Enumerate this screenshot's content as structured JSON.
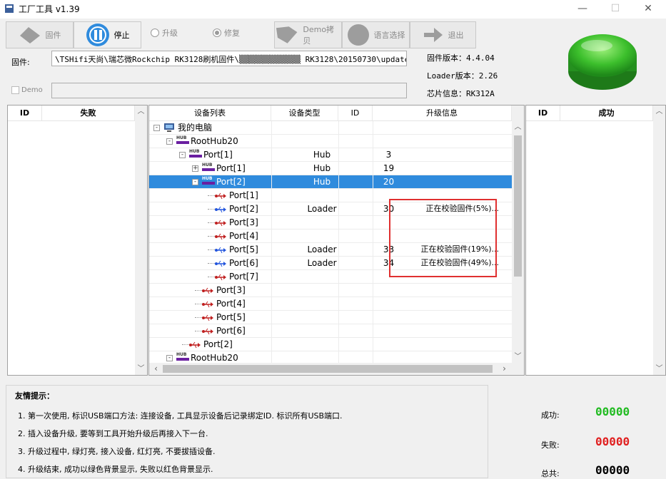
{
  "window": {
    "title": "工厂工具 v1.39",
    "minimize": "—",
    "maximize": "☐",
    "close": "✕"
  },
  "toolbar": {
    "firmware": "固件",
    "stop": "停止",
    "upgrade": "升级",
    "repair": "修复",
    "demo_copy": "Demo拷贝",
    "language": "语言选择",
    "exit": "退出",
    "selected_mode": "repair"
  },
  "firmware_row": {
    "label": "固件:",
    "path": "\\TSHifi天尚\\瑞芯微Rockchip RK3128刷机固件\\▒▒▒▒▒▒▒▒▒▒▒▒▒ RK3128\\20150730\\update.img",
    "demo_label": "Demo",
    "demo_value": ""
  },
  "versions": {
    "firmware_version": "固件版本：4.4.04",
    "loader_version": "Loader版本：2.26",
    "chip_info": "芯片信息：RK312A"
  },
  "fail_panel": {
    "col_id": "ID",
    "col_title": "失败"
  },
  "success_panel": {
    "col_id": "ID",
    "col_title": "成功"
  },
  "devices": {
    "headers": [
      "设备列表",
      "设备类型",
      "ID",
      "升级信息"
    ],
    "rows": [
      {
        "name": "我的电脑",
        "type": "",
        "id": "",
        "info": "",
        "icon": "computer-icon",
        "level": 0,
        "expander": "-"
      },
      {
        "name": "RootHub20",
        "type": "",
        "id": "",
        "info": "",
        "icon": "hub-icon",
        "level": 1,
        "expander": "-"
      },
      {
        "name": "Port[1]",
        "type": "Hub",
        "id": "3",
        "info": "",
        "icon": "hub-icon",
        "level": 2,
        "expander": "-"
      },
      {
        "name": "Port[1]",
        "type": "Hub",
        "id": "19",
        "info": "",
        "icon": "hub-icon",
        "level": 3,
        "expander": "+"
      },
      {
        "name": "Port[2]",
        "type": "Hub",
        "id": "20",
        "info": "",
        "icon": "hub-icon",
        "level": 3,
        "expander": "-",
        "selected": true
      },
      {
        "name": "Port[1]",
        "type": "",
        "id": "",
        "info": "",
        "icon": "usb-red-icon",
        "level": 4
      },
      {
        "name": "Port[2]",
        "type": "Loader",
        "id": "30",
        "info": "正在校验固件(5%)...",
        "icon": "usb-blue-icon",
        "level": 4
      },
      {
        "name": "Port[3]",
        "type": "",
        "id": "",
        "info": "",
        "icon": "usb-red-icon",
        "level": 4
      },
      {
        "name": "Port[4]",
        "type": "",
        "id": "",
        "info": "",
        "icon": "usb-red-icon",
        "level": 4
      },
      {
        "name": "Port[5]",
        "type": "Loader",
        "id": "33",
        "info": "正在校验固件(19%)...",
        "icon": "usb-blue-icon",
        "level": 4
      },
      {
        "name": "Port[6]",
        "type": "Loader",
        "id": "34",
        "info": "正在校验固件(49%)...",
        "icon": "usb-blue-icon",
        "level": 4
      },
      {
        "name": "Port[7]",
        "type": "",
        "id": "",
        "info": "",
        "icon": "usb-red-icon",
        "level": 4
      },
      {
        "name": "Port[3]",
        "type": "",
        "id": "",
        "info": "",
        "icon": "usb-red-icon",
        "level": 3
      },
      {
        "name": "Port[4]",
        "type": "",
        "id": "",
        "info": "",
        "icon": "usb-red-icon",
        "level": 3
      },
      {
        "name": "Port[5]",
        "type": "",
        "id": "",
        "info": "",
        "icon": "usb-red-icon",
        "level": 3
      },
      {
        "name": "Port[6]",
        "type": "",
        "id": "",
        "info": "",
        "icon": "usb-red-icon",
        "level": 3
      },
      {
        "name": "Port[2]",
        "type": "",
        "id": "",
        "info": "",
        "icon": "usb-red-icon",
        "level": 2
      },
      {
        "name": "RootHub20",
        "type": "",
        "id": "",
        "info": "",
        "icon": "hub-icon",
        "level": 1,
        "expander": "-"
      }
    ]
  },
  "tips": {
    "title": "友情提示：",
    "items": [
      "1. 第一次使用, 标识USB端口方法: 连接设备, 工具显示设备后记录绑定ID. 标识所有USB端口.",
      "2. 插入设备升级, 要等到工具开始升级后再接入下一台.",
      "3. 升级过程中, 绿灯亮, 接入设备, 红灯亮, 不要拔插设备.",
      "4. 升级结束, 成功以绿色背景显示, 失败以红色背景显示."
    ]
  },
  "stats": {
    "success_label": "成功:",
    "success_value": "00000",
    "fail_label": "失败:",
    "fail_value": "00000",
    "total_label": "总共:",
    "total_value": "00000"
  },
  "colors": {
    "selection": "#2f8bdd",
    "success": "#22bb22",
    "fail": "#e02020",
    "highlight_box": "#e03030",
    "hub_bar": "#6a1fa0"
  }
}
